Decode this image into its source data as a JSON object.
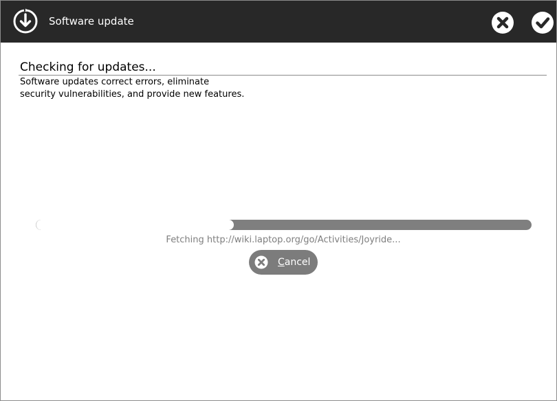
{
  "window": {
    "title": "Software update"
  },
  "toolbar": {
    "cancel_icon": "x-circle-icon",
    "ok_icon": "checkmark-circle-icon",
    "app_icon": "software-update-icon"
  },
  "content": {
    "heading": "Checking for updates...",
    "description": "Software updates correct errors, eliminate\nsecurity vulnerabilities, and provide new features."
  },
  "progress": {
    "fraction": 0.4
  },
  "status": {
    "text": "Fetching http://wiki.laptop.org/go/Activities/Joyride..."
  },
  "cancel_button": {
    "mnemonic": "C",
    "label_rest": "ancel",
    "icon": "x-circle-icon"
  },
  "colors": {
    "titlebar": "#282828",
    "progress_track": "#7f7f7f",
    "button": "#7c7c7c"
  }
}
